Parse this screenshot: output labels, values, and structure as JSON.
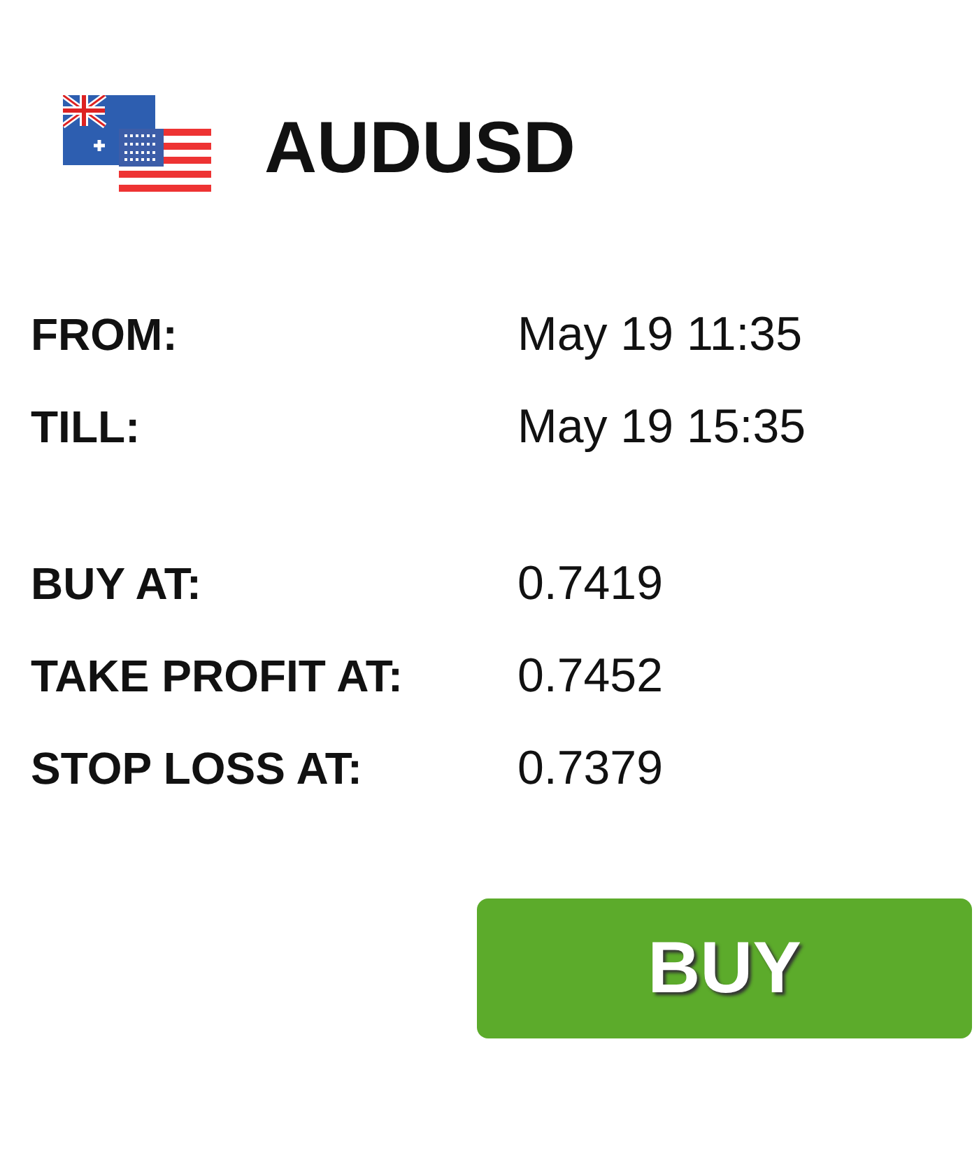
{
  "pair": {
    "symbol": "AUDUSD"
  },
  "sections": [
    {
      "rows": [
        {
          "label": "FROM:",
          "value": "May 19 11:35"
        },
        {
          "label": "TILL:",
          "value": "May 19 15:35"
        }
      ]
    },
    {
      "rows": [
        {
          "label": "BUY AT:",
          "value": "0.7419"
        },
        {
          "label": "TAKE PROFIT AT:",
          "value": "0.7452"
        },
        {
          "label": "STOP LOSS AT:",
          "value": "0.7379"
        }
      ]
    }
  ],
  "action_button": {
    "label": "BUY"
  }
}
